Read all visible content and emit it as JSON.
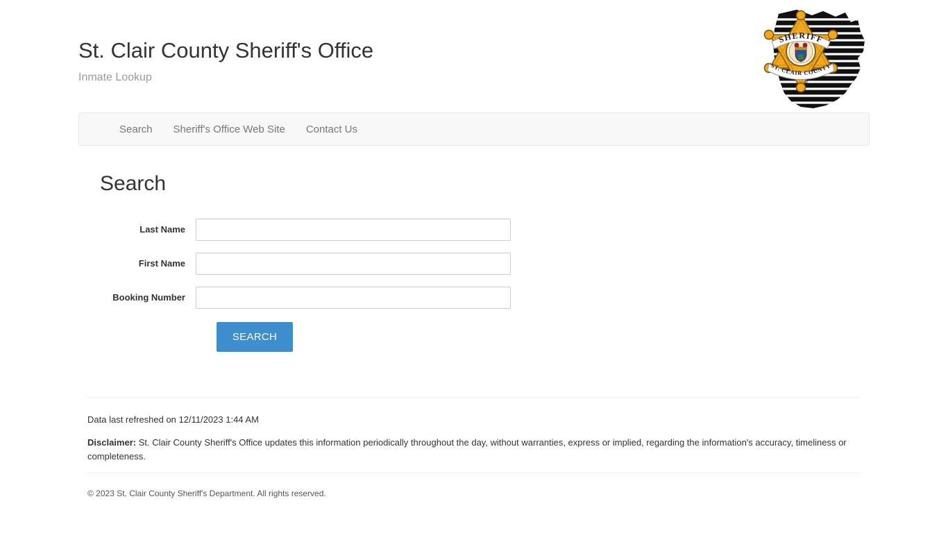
{
  "header": {
    "title": "St. Clair County Sheriff's Office",
    "subtitle": "Inmate Lookup",
    "logo_alt": "sheriff-badge-michigan-logo",
    "logo_star_text_top": "SHERIFF",
    "logo_star_text_bottom": "ST. CLAIR COUNTY"
  },
  "nav": {
    "items": [
      {
        "label": "Search",
        "name": "nav-item-search"
      },
      {
        "label": "Sheriff's Office Web Site",
        "name": "nav-item-sheriffs-office-web-site"
      },
      {
        "label": "Contact Us",
        "name": "nav-item-contact-us"
      }
    ]
  },
  "main": {
    "heading": "Search",
    "fields": [
      {
        "label": "Last Name",
        "value": "",
        "placeholder": "",
        "name": "last-name"
      },
      {
        "label": "First Name",
        "value": "",
        "placeholder": "",
        "name": "first-name"
      },
      {
        "label": "Booking Number",
        "value": "",
        "placeholder": "",
        "name": "booking-number"
      }
    ],
    "search_button_label": "SEARCH"
  },
  "footer": {
    "refresh_text": "Data last refreshed on 12/11/2023 1:44 AM",
    "disclaimer_label": "Disclaimer:",
    "disclaimer_text": " St. Clair County Sheriff's Office updates this information periodically throughout the day, without warranties, express or implied, regarding the information's accuracy, timeliness or completeness.",
    "copyright": "© 2023 St. Clair County Sheriff's Department. All rights reserved."
  },
  "colors": {
    "accent_blue": "#3d8ecc",
    "navbar_bg": "#f8f8f8",
    "navbar_border": "#e7e7e7",
    "input_border": "#cccccc",
    "text_dark": "#333333",
    "text_muted": "#9a9a9a",
    "badge_gold": "#f0a81e",
    "page_bg": "#ffffff"
  }
}
